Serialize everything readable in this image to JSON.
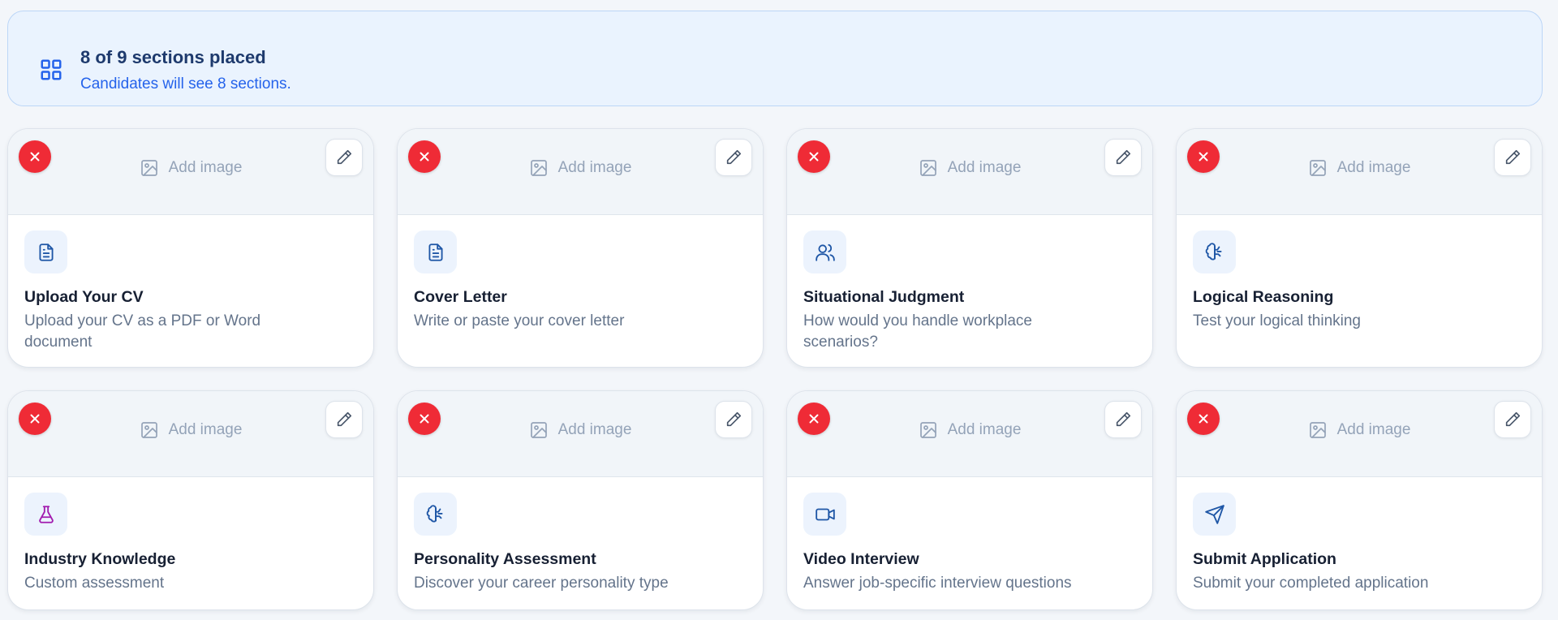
{
  "banner": {
    "icon": "grid-icon",
    "title": "8 of 9 sections placed",
    "subtitle": "Candidates will see 8 sections."
  },
  "card_common": {
    "add_image_label": "Add image",
    "remove_icon": "close-icon",
    "edit_icon": "pencil-icon",
    "image_icon": "image-icon"
  },
  "sections": [
    {
      "title": "Upload Your CV",
      "description": "Upload your CV as a PDF or Word document",
      "icon": "document-icon",
      "icon_color": "#1e56a6"
    },
    {
      "title": "Cover Letter",
      "description": "Write or paste your cover letter",
      "icon": "document-icon",
      "icon_color": "#1e56a6"
    },
    {
      "title": "Situational Judgment",
      "description": "How would you handle workplace scenarios?",
      "icon": "users-icon",
      "icon_color": "#1e56a6"
    },
    {
      "title": "Logical Reasoning",
      "description": "Test your logical thinking",
      "icon": "brain-icon",
      "icon_color": "#1e56a6"
    },
    {
      "title": "Industry Knowledge",
      "description": "Custom assessment",
      "icon": "flask-icon",
      "icon_color": "#a21caf"
    },
    {
      "title": "Personality Assessment",
      "description": "Discover your career personality type",
      "icon": "brain-icon",
      "icon_color": "#1e56a6"
    },
    {
      "title": "Video Interview",
      "description": "Answer job-specific interview questions",
      "icon": "video-icon",
      "icon_color": "#1e56a6"
    },
    {
      "title": "Submit Application",
      "description": "Submit your completed application",
      "icon": "send-icon",
      "icon_color": "#1e56a6"
    }
  ],
  "colors": {
    "accent": "#2563eb",
    "remove": "#ef2b36",
    "banner_bg": "#eaf3fe",
    "icon_tile_bg": "#ecf3fd"
  }
}
